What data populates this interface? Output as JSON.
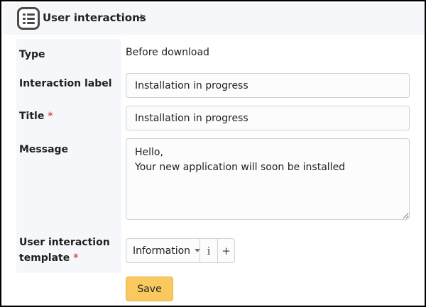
{
  "header": {
    "title": "User interactions",
    "add_symbol": "+",
    "icon": "list-icon"
  },
  "form": {
    "type": {
      "label": "Type",
      "value": "Before download"
    },
    "interaction_label": {
      "label": "Interaction label",
      "value": "Installation in progress"
    },
    "title": {
      "label": "Title",
      "required_mark": "*",
      "value": "Installation in progress"
    },
    "message": {
      "label": "Message",
      "value": "Hello,\nYour new application will soon be installed"
    },
    "template": {
      "label_line1": "User interaction",
      "label_line2": "template",
      "required_mark": "*",
      "selected": "Information",
      "info_symbol": "i",
      "add_symbol": "+"
    }
  },
  "actions": {
    "save_label": "Save"
  },
  "colors": {
    "required": "#d9534f",
    "save_button": "#f9c95f",
    "label_background": "#f6f7fa"
  }
}
